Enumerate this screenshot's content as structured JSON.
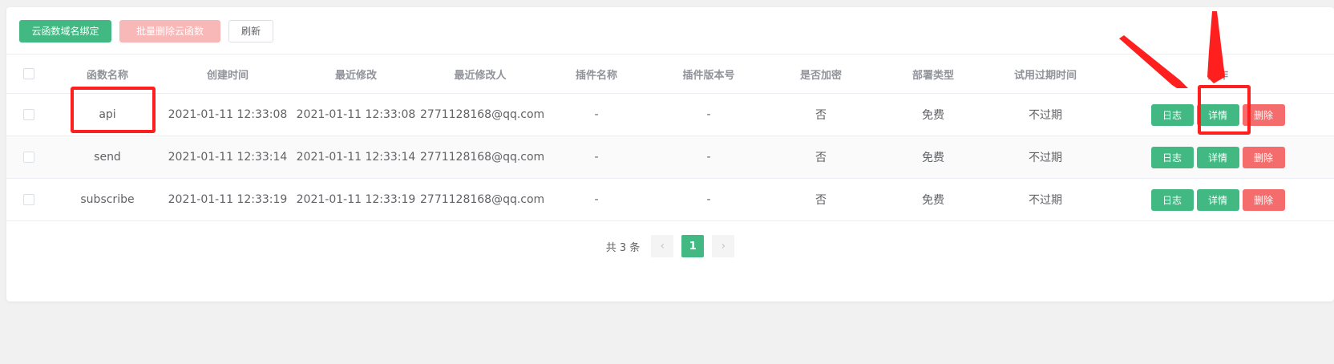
{
  "toolbar": {
    "bind_domain": "云函数域名绑定",
    "batch_delete": "批量删除云函数",
    "refresh": "刷新"
  },
  "table": {
    "headers": [
      "函数名称",
      "创建时间",
      "最近修改",
      "最近修改人",
      "插件名称",
      "插件版本号",
      "是否加密",
      "部署类型",
      "试用过期时间",
      "操作"
    ],
    "rows": [
      {
        "name": "api",
        "created": "2021-01-11 12:33:08",
        "modified": "2021-01-11 12:33:08",
        "modifier": "2771128168@qq.com",
        "plugin": "-",
        "version": "-",
        "encrypted": "否",
        "deploy": "免费",
        "expiry": "不过期"
      },
      {
        "name": "send",
        "created": "2021-01-11 12:33:14",
        "modified": "2021-01-11 12:33:14",
        "modifier": "2771128168@qq.com",
        "plugin": "-",
        "version": "-",
        "encrypted": "否",
        "deploy": "免费",
        "expiry": "不过期"
      },
      {
        "name": "subscribe",
        "created": "2021-01-11 12:33:19",
        "modified": "2021-01-11 12:33:19",
        "modifier": "2771128168@qq.com",
        "plugin": "-",
        "version": "-",
        "encrypted": "否",
        "deploy": "免费",
        "expiry": "不过期"
      }
    ],
    "actions": {
      "log": "日志",
      "detail": "详情",
      "delete": "删除"
    }
  },
  "pagination": {
    "total": "共 3 条",
    "current": "1",
    "prev_icon": "chevron-left-icon",
    "next_icon": "chevron-right-icon"
  },
  "colors": {
    "primary": "#42b983",
    "danger": "#f56c6c",
    "annotation": "#ff1f1f"
  }
}
